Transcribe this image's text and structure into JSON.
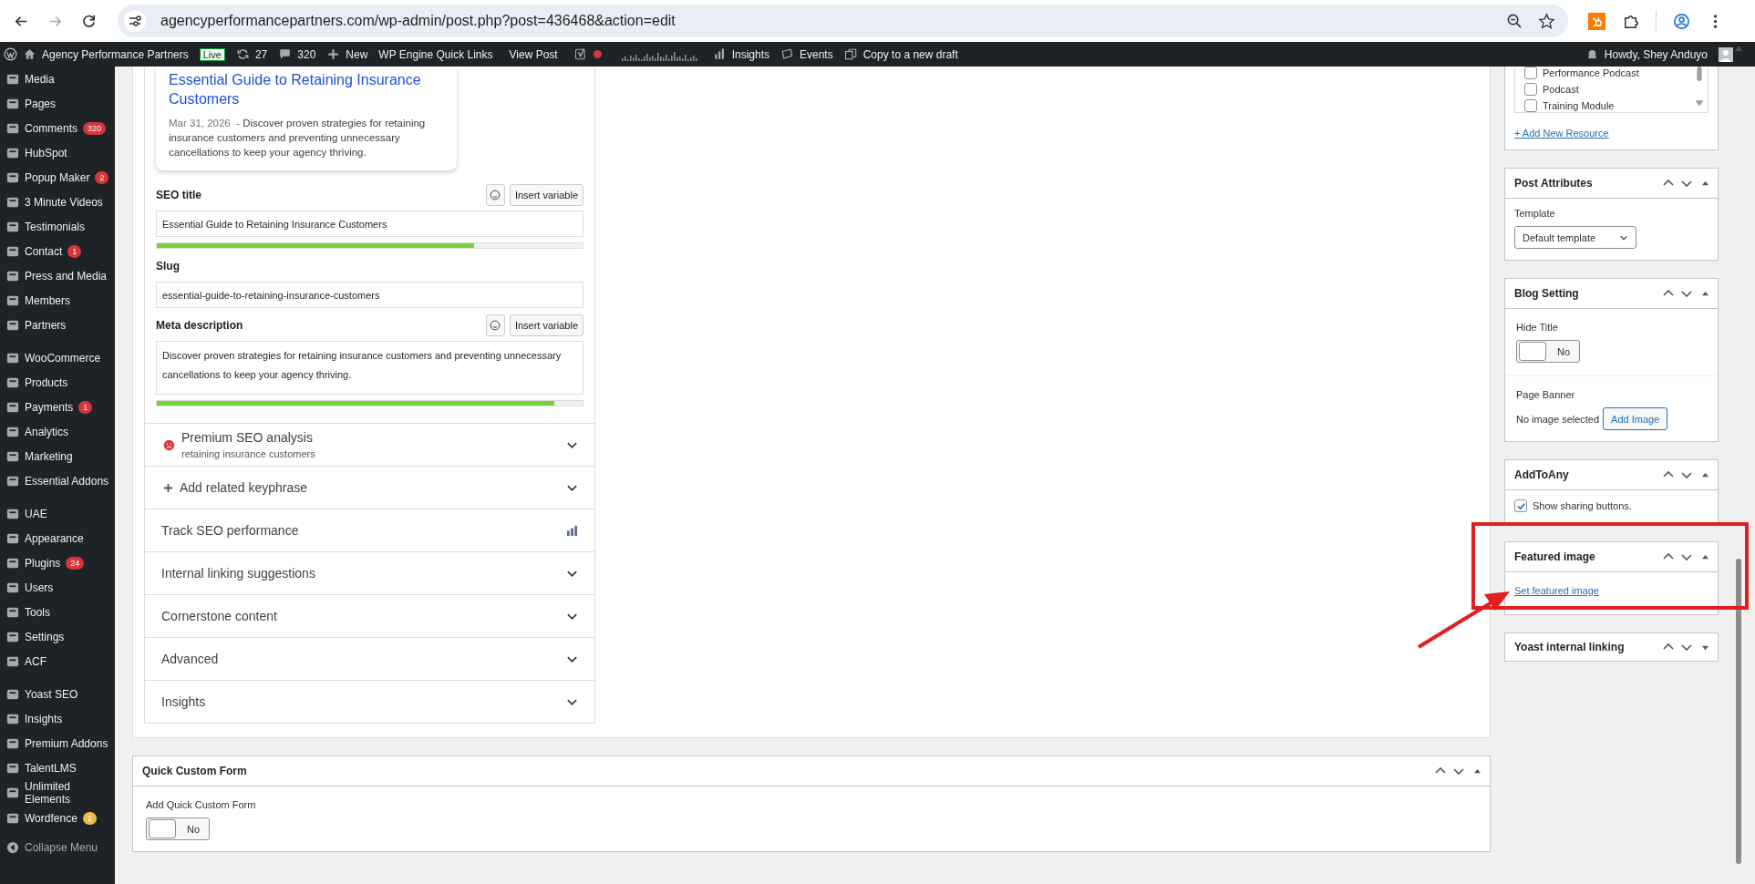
{
  "browser": {
    "url": "agencyperformancepartners.com/wp-admin/post.php?post=436468&action=edit"
  },
  "admin_bar": {
    "site": "Agency Performance Partners",
    "environment": "Live",
    "updates": "27",
    "comments": "320",
    "new": "New",
    "links": [
      "WP Engine Quick Links",
      "View Post"
    ],
    "insights": "Insights",
    "events": "Events",
    "copy": "Copy to a new draft",
    "greeting": "Howdy, Shey Anduyo"
  },
  "sidebar": {
    "groups": [
      {
        "items": [
          {
            "label": "Media"
          },
          {
            "label": "Pages"
          },
          {
            "label": "Comments",
            "badge": "320",
            "color": "#d63638"
          },
          {
            "label": "HubSpot"
          },
          {
            "label": "Popup Maker",
            "badge": "2",
            "color": "#d63638"
          },
          {
            "label": "3 Minute Videos"
          },
          {
            "label": "Testimonials"
          },
          {
            "label": "Contact",
            "badge": "1",
            "color": "#d63638"
          },
          {
            "label": "Press and Media"
          },
          {
            "label": "Members"
          },
          {
            "label": "Partners"
          }
        ]
      },
      {
        "items": [
          {
            "label": "WooCommerce"
          },
          {
            "label": "Products"
          },
          {
            "label": "Payments",
            "badge": "1",
            "color": "#d63638"
          },
          {
            "label": "Analytics"
          },
          {
            "label": "Marketing"
          },
          {
            "label": "Essential Addons"
          }
        ]
      },
      {
        "items": [
          {
            "label": "UAE"
          },
          {
            "label": "Appearance"
          },
          {
            "label": "Plugins",
            "badge": "24",
            "color": "#d63638"
          },
          {
            "label": "Users"
          },
          {
            "label": "Tools"
          },
          {
            "label": "Settings"
          },
          {
            "label": "ACF"
          }
        ]
      },
      {
        "items": [
          {
            "label": "Yoast SEO"
          },
          {
            "label": "Insights"
          },
          {
            "label": "Premium Addons"
          },
          {
            "label": "TalentLMS"
          },
          {
            "label": "Unlimited Elements"
          },
          {
            "label": "Wordfence",
            "badge": "2",
            "color": "#f0b849"
          }
        ]
      }
    ],
    "collapse": "Collapse Menu"
  },
  "snippet": {
    "title": "Essential Guide to Retaining Insurance Customers",
    "date": "Mar 31, 2026",
    "separator": "-",
    "description": "Discover proven strategies for retaining insurance customers and preventing unnecessary cancellations to keep your agency thriving."
  },
  "seo_title": {
    "label": "SEO title",
    "insert": "Insert variable",
    "value": "Essential Guide to Retaining Insurance Customers",
    "level": 0.745
  },
  "slug": {
    "label": "Slug",
    "value": "essential-guide-to-retaining-insurance-customers"
  },
  "meta_description": {
    "label": "Meta description",
    "insert": "Insert variable",
    "value": "Discover proven strategies for retaining insurance customers and preventing unnecessary cancellations to keep your agency thriving.",
    "level": 0.934
  },
  "yoast_sections": [
    {
      "kind": "analysis",
      "title": "Premium SEO analysis",
      "subtitle": "retaining insurance customers"
    },
    {
      "kind": "add",
      "title": "Add related keyphrase"
    },
    {
      "kind": "track",
      "title": "Track SEO performance"
    },
    {
      "kind": "collapsible",
      "title": "Internal linking suggestions"
    },
    {
      "kind": "collapsible",
      "title": "Cornerstone content"
    },
    {
      "kind": "collapsible",
      "title": "Advanced"
    },
    {
      "kind": "collapsible",
      "title": "Insights"
    }
  ],
  "quick_custom_form": {
    "title": "Quick Custom Form",
    "label": "Add Quick Custom Form",
    "toggle": {
      "text": "No",
      "on": false
    }
  },
  "side_boxes": [
    {
      "kind": "resources",
      "resources": [
        {
          "label": "Performance Podcast",
          "checked": false
        },
        {
          "label": "Podcast",
          "checked": false
        },
        {
          "label": "Training Module",
          "checked": false
        }
      ],
      "add_link": "+ Add New Resource"
    },
    {
      "kind": "attributes",
      "title": "Post Attributes",
      "expanded": true,
      "template_label": "Template",
      "template": "Default template"
    },
    {
      "kind": "blog",
      "title": "Blog Setting",
      "expanded": true,
      "hide_title": "Hide Title",
      "toggle": {
        "text": "No",
        "on": false
      },
      "banner_label": "Page Banner",
      "banner_status": "No image selected",
      "banner_button": "Add Image"
    },
    {
      "kind": "addtoany",
      "title": "AddToAny",
      "expanded": true,
      "option": {
        "label": "Show sharing buttons.",
        "checked": true
      }
    },
    {
      "kind": "featured",
      "title": "Featured image",
      "expanded": true,
      "link": "Set featured image"
    },
    {
      "title": "Yoast internal linking",
      "expanded": false
    }
  ]
}
